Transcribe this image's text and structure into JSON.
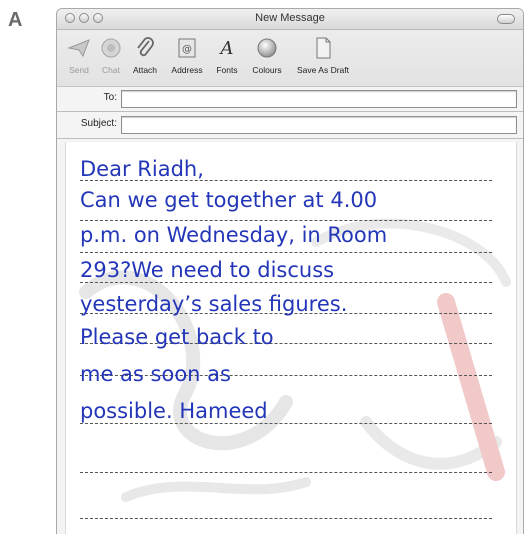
{
  "exercise_label": "A",
  "window": {
    "title": "New Message"
  },
  "toolbar": {
    "items": [
      {
        "label": "Send",
        "icon": "send-icon",
        "enabled": false
      },
      {
        "label": "Chat",
        "icon": "chat-icon",
        "enabled": false
      },
      {
        "label": "Attach",
        "icon": "paperclip-icon",
        "enabled": true
      },
      {
        "label": "Address",
        "icon": "address-book-icon",
        "enabled": true
      },
      {
        "label": "Fonts",
        "icon": "fonts-icon",
        "enabled": true
      },
      {
        "label": "Colours",
        "icon": "colour-wheel-icon",
        "enabled": true
      },
      {
        "label": "Save As Draft",
        "icon": "draft-document-icon",
        "enabled": true
      }
    ]
  },
  "headers": {
    "to_label": "To:",
    "to_value": "",
    "subject_label": "Subject:",
    "subject_value": ""
  },
  "message": {
    "lines": [
      "Dear Riadh,",
      "Can we get together at 4.00",
      "p.m. on Wednesday, in Room",
      "293?We need to discuss",
      "yesterday’s sales figures.",
      "Please get back to",
      "me as soon as",
      "possible. Hameed"
    ]
  },
  "colors": {
    "handwriting": "#2336b8",
    "window_bg": "#f4f4f4"
  }
}
